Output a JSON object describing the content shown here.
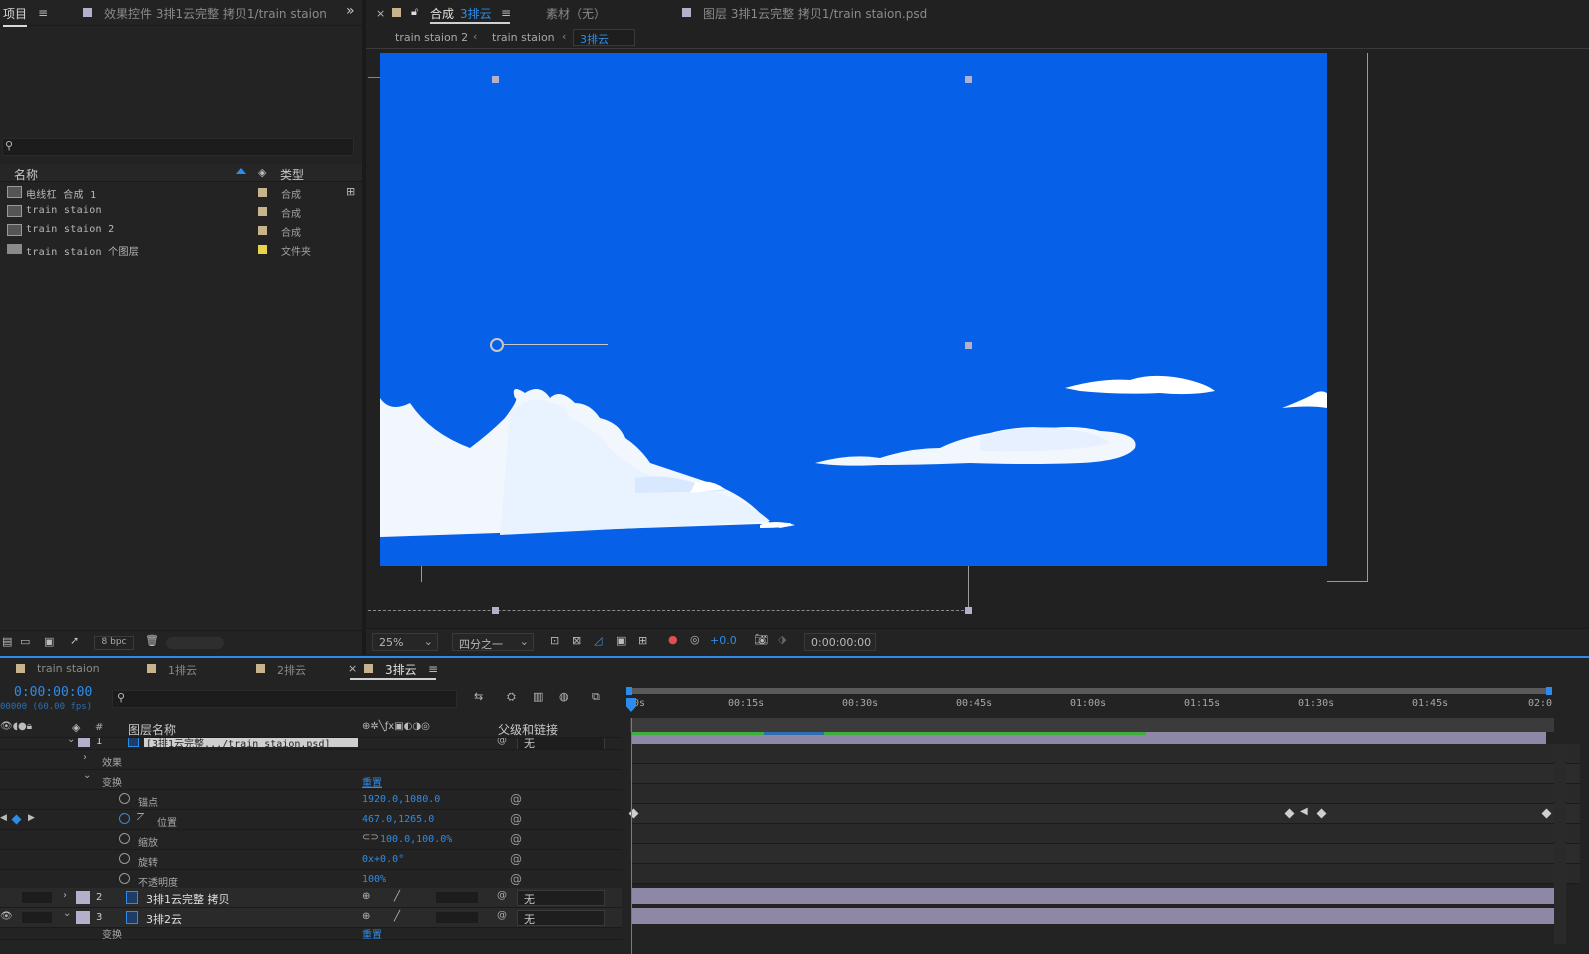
{
  "project_panel": {
    "tab_label": "项目",
    "effects_tab": "效果控件 3排1云完整 拷贝1/train staion.",
    "search_placeholder": "",
    "col_name": "名称",
    "col_type": "类型",
    "items": [
      {
        "name": "电线杠 合成 1",
        "type": "合成",
        "tag_color": "#c8b48c"
      },
      {
        "name": "train staion",
        "type": "合成",
        "tag_color": "#c8b48c"
      },
      {
        "name": "train staion 2",
        "type": "合成",
        "tag_color": "#c8b48c"
      },
      {
        "name": "train staion 个图层",
        "type": "文件夹",
        "tag_color": "#e6d44a"
      }
    ],
    "bpc": "8 bpc"
  },
  "viewer": {
    "comp_tab_prefix": "合成",
    "comp_tab_name": "3排云",
    "footage_tab": "素材（无）",
    "layer_tab": "图层 3排1云完整 拷贝1/train staion.psd",
    "breadcrumbs": [
      "train staion 2",
      "train staion",
      "3排云"
    ],
    "zoom": "25%",
    "resolution": "四分之一",
    "exposure": "+0.0",
    "timecode": "0:00:00:00"
  },
  "timeline": {
    "tabs": [
      "train staion",
      "1排云",
      "2排云",
      "3排云"
    ],
    "current_time": "0:00:00:00",
    "frames_info": "00000 (60.00 fps)",
    "col_layer_name": "图层名称",
    "col_parent": "父级和链接",
    "ruler": [
      "0s",
      "00:15s",
      "00:30s",
      "00:45s",
      "01:00s",
      "01:15s",
      "01:30s",
      "01:45s",
      "02:0"
    ],
    "layers": [
      {
        "num": "1",
        "name": "[3排1云完整.../train staion.psd]",
        "parent": "无"
      },
      {
        "num": "2",
        "name": "3排1云完整 拷贝",
        "parent": "无"
      },
      {
        "num": "3",
        "name": "3排2云",
        "parent": "无"
      }
    ],
    "groups": {
      "effects": "效果",
      "transform": "变换",
      "reset": "重置"
    },
    "properties": [
      {
        "name": "锚点",
        "value": "1920.0,1080.0"
      },
      {
        "name": "位置",
        "value": "467.0,1265.0"
      },
      {
        "name": "缩放",
        "value": "100.0,100.0%"
      },
      {
        "name": "旋转",
        "value": "0x+0.0°"
      },
      {
        "name": "不透明度",
        "value": "100%"
      }
    ],
    "bottom_group": "变换",
    "bottom_reset": "重置"
  },
  "colors": {
    "accent": "#2d8ceb",
    "canvas": "#0761e8",
    "layer_bar": "#8e87a6",
    "green_bar": "#3fae3f"
  }
}
